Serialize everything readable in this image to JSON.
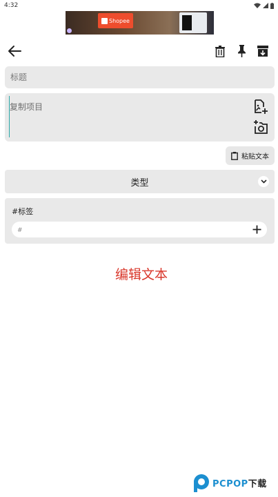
{
  "status_bar": {
    "time": "4:32"
  },
  "ad": {
    "brand": "Shopee"
  },
  "toolbar": {
    "back_icon": "arrow-left-icon",
    "delete_icon": "trash-icon",
    "pin_icon": "pin-icon",
    "archive_icon": "archive-icon"
  },
  "form": {
    "title_placeholder": "标题",
    "title_value": "",
    "content_placeholder": "复制项目",
    "content_value": "",
    "paste_label": "粘贴文本",
    "type_label": "类型",
    "tags_label": "#标签",
    "tag_placeholder": "#",
    "edit_text_label": "编辑文本"
  },
  "watermark": {
    "brand": "PCPOP",
    "suffix": "下载"
  },
  "colors": {
    "accent": "#d9372b",
    "field_bg": "#e9e9e9",
    "cursor": "#2aa7a7"
  }
}
